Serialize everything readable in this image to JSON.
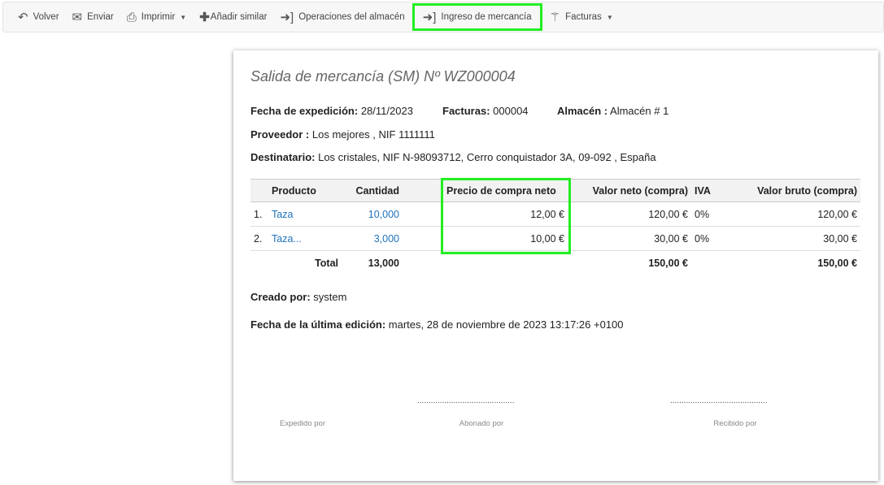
{
  "toolbar": {
    "items": [
      {
        "label": "Volver",
        "icon": "undo-icon"
      },
      {
        "label": "Enviar",
        "icon": "envelope-icon"
      },
      {
        "label": "Imprimir",
        "icon": "printer-icon"
      },
      {
        "label": "Añadir similar",
        "icon": "plus-icon"
      },
      {
        "label": "Operaciones del almacén",
        "icon": "sign-in-icon"
      },
      {
        "label": "Ingreso de mercancía",
        "icon": "sign-in-icon"
      },
      {
        "label": "Facturas",
        "icon": "magic-wand-icon"
      }
    ]
  },
  "doc": {
    "title": "Salida de mercancía (SM) Nº WZ000004",
    "fecha_label": "Fecha de expedición:",
    "fecha": "28/11/2023",
    "facturas_label": "Facturas:",
    "facturas": "000004",
    "almacen_label": "Almacén :",
    "almacen": "Almacén # 1",
    "proveedor_label": "Proveedor :",
    "proveedor": "Los mejores , NIF 1111111",
    "destinatario_label": "Destinatario:",
    "destinatario": "Los cristales, NIF N-98093712, Cerro conquistador 3A, 09-092 , España",
    "table": {
      "headers": [
        "Producto",
        "Cantidad",
        "Precio de compra neto",
        "Valor neto (compra)",
        "IVA",
        "Valor bruto (compra)"
      ],
      "rows": [
        {
          "n": "1.",
          "producto": "Taza",
          "cantidad": "10,000",
          "precio": "12,00 €",
          "neto": "120,00 €",
          "iva": "0%",
          "bruto": "120,00 €"
        },
        {
          "n": "2.",
          "producto": "Taza...",
          "cantidad": "3,000",
          "precio": "10,00 €",
          "neto": "30,00 €",
          "iva": "0%",
          "bruto": "30,00 €"
        }
      ],
      "total": {
        "label": "Total",
        "cantidad": "13,000",
        "neto": "150,00 €",
        "bruto": "150,00 €"
      }
    },
    "creado_label": "Creado por:",
    "creado": "system",
    "edicion_label": "Fecha de la última edición:",
    "edicion": "martes, 28 de noviembre de 2023 13:17:26 +0100",
    "sig": {
      "expedido": "Expedido por",
      "abonado": "Abonado por",
      "recibido": "Recibido por",
      "dots": "..........................................."
    }
  }
}
